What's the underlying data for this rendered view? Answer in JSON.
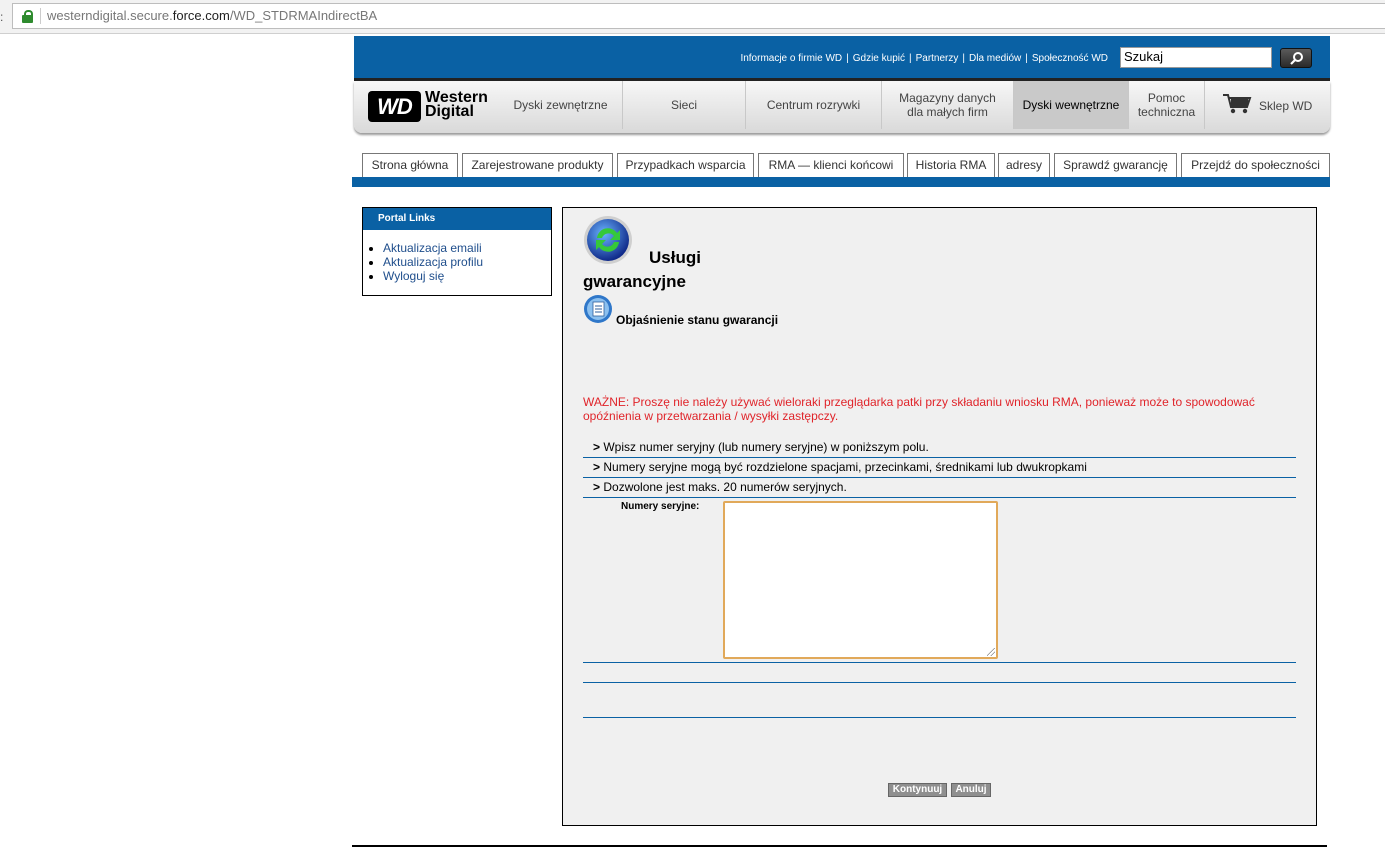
{
  "browser": {
    "url_prefix": "westerndigital.secure.",
    "url_host": "force.com",
    "url_path": "/WD_STDRMAIndirectBA"
  },
  "header": {
    "top_links": [
      "Informacje o firmie WD",
      "Gdzie kupić",
      "Partnerzy",
      "Dla mediów",
      "Społeczność WD"
    ],
    "top_link_separator": "|",
    "search_value": "Szukaj",
    "logo_mark": "WD",
    "logo_line1": "Western",
    "logo_line2": "Digital",
    "nav": [
      {
        "label": "Dyski zewnętrzne",
        "active": false
      },
      {
        "label": "Sieci",
        "active": false
      },
      {
        "label": "Centrum rozrywki",
        "active": false
      },
      {
        "label": "Magazyny danych dla małych firm",
        "active": false
      },
      {
        "label": "Dyski wewnętrzne",
        "active": true
      },
      {
        "label": "Pomoc techniczna",
        "active": false
      }
    ],
    "shop_label": "Sklep WD",
    "brand_color": "#0a61a4"
  },
  "tabs": [
    "Strona główna",
    "Zarejestrowane produkty",
    "Przypadkach wsparcia",
    "RMA — klienci końcowi",
    "Historia RMA",
    "adresy",
    "Sprawdź gwarancję",
    "Przejdź do społeczności"
  ],
  "portal": {
    "heading": "Portal Links",
    "links": [
      "Aktualizacja emaili",
      "Aktualizacja profilu",
      "Wyloguj się"
    ]
  },
  "main": {
    "title_line1": "Usługi",
    "title_line2": "gwarancyjne",
    "explain_link": "Objaśnienie stanu gwarancji",
    "warning": "WAŻNE: Proszę nie należy używać wieloraki przeglądarka patki przy składaniu wniosku RMA, ponieważ może to spowodować opóźnienia w przetwarzania / wysyłki zastępczy.",
    "warning_color": "#e0242a",
    "instructions": [
      "Wpisz numer seryjny (lub numery seryjne) w poniższym polu.",
      "Numery seryjne mogą być rozdzielone spacjami, przecinkami, średnikami lub dwukropkami",
      "Dozwolone jest maks. 20 numerów seryjnych."
    ],
    "instruction_marker": ">",
    "serial_label": "Numery seryjne:",
    "serial_value": "",
    "continue_label": "Kontynuuj",
    "cancel_label": "Anuluj"
  }
}
